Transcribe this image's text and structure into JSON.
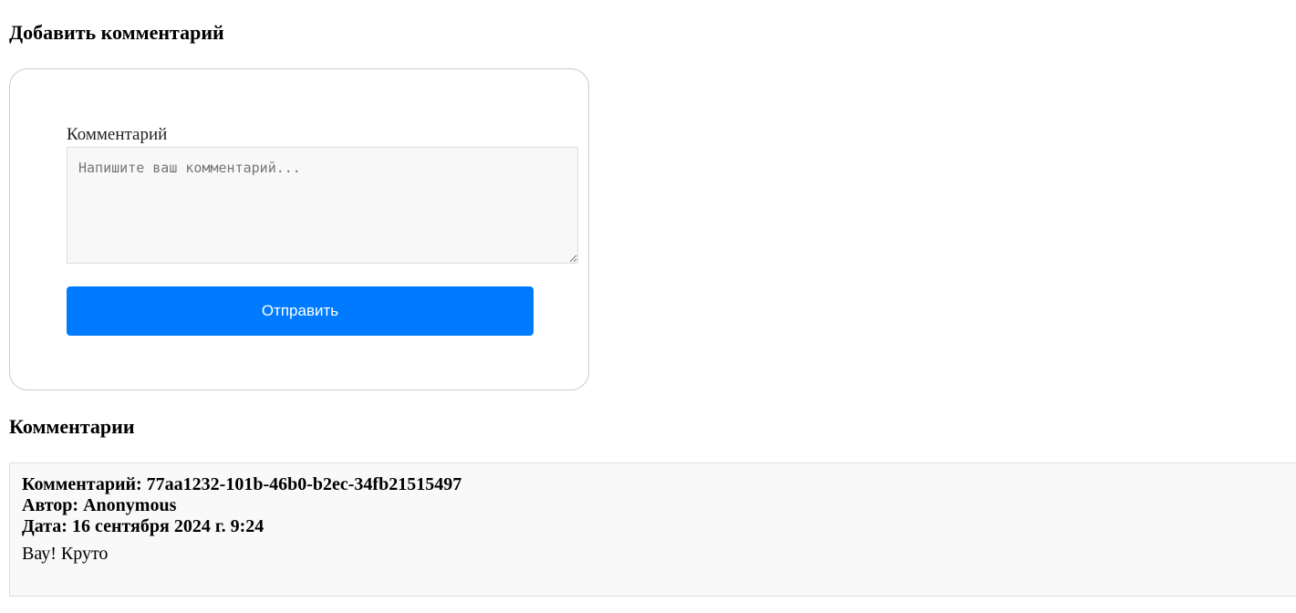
{
  "form": {
    "title": "Добавить комментарий",
    "field_label": "Комментарий",
    "textarea_value": "",
    "textarea_placeholder": "Напишите ваш комментарий...",
    "submit_label": "Отправить"
  },
  "comments": {
    "title": "Комментарии",
    "items": [
      {
        "id_line": "Комментарий: 77aa1232-101b-46b0-b2ec-34fb21515497",
        "author_line": "Автор: Anonymous",
        "date_line": "Дата: 16 сентября 2024 г. 9:24",
        "text": "Вау! Круто"
      }
    ]
  },
  "colors": {
    "accent": "#007bff",
    "card_border": "#cccccc",
    "comment_background": "#f9f9f9"
  }
}
